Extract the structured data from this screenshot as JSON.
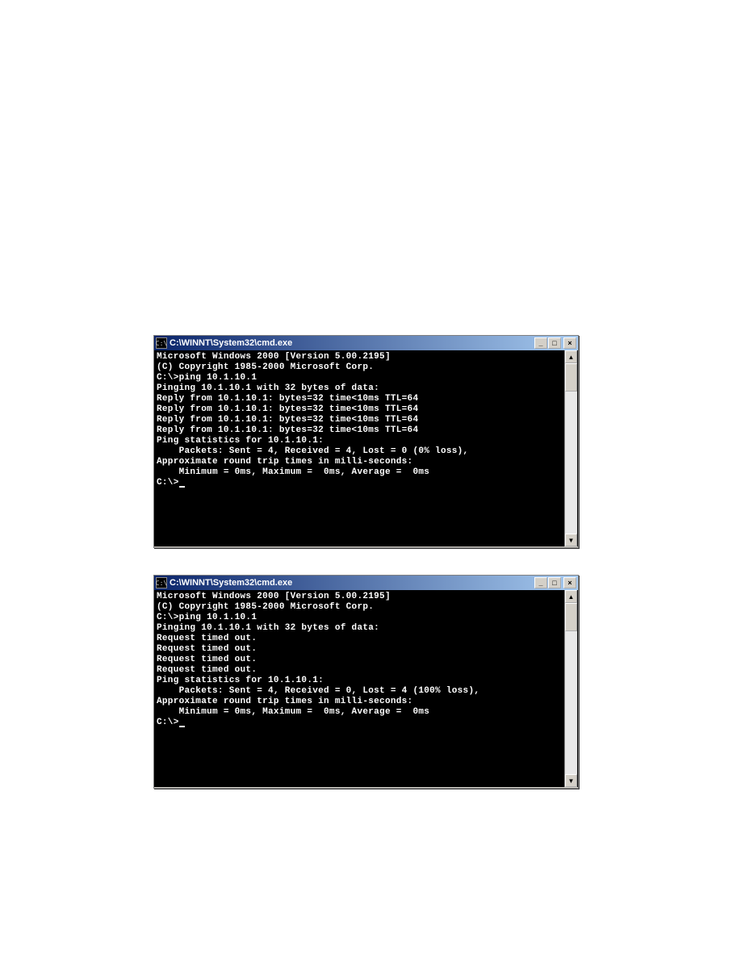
{
  "window1": {
    "icon_label": "C:\\",
    "title": "C:\\WINNT\\System32\\cmd.exe",
    "buttons": {
      "min": "_",
      "max": "□",
      "close": "×"
    },
    "scroll": {
      "up": "▲",
      "down": "▼"
    },
    "lines": [
      "Microsoft Windows 2000 [Version 5.00.2195]",
      "(C) Copyright 1985-2000 Microsoft Corp.",
      "",
      "C:\\>ping 10.1.10.1",
      "",
      "Pinging 10.1.10.1 with 32 bytes of data:",
      "",
      "Reply from 10.1.10.1: bytes=32 time<10ms TTL=64",
      "Reply from 10.1.10.1: bytes=32 time<10ms TTL=64",
      "Reply from 10.1.10.1: bytes=32 time<10ms TTL=64",
      "Reply from 10.1.10.1: bytes=32 time<10ms TTL=64",
      "",
      "Ping statistics for 10.1.10.1:",
      "    Packets: Sent = 4, Received = 4, Lost = 0 (0% loss),",
      "Approximate round trip times in milli-seconds:",
      "    Minimum = 0ms, Maximum =  0ms, Average =  0ms",
      "",
      "C:\\>"
    ]
  },
  "window2": {
    "icon_label": "C:\\",
    "title": "C:\\WINNT\\System32\\cmd.exe",
    "buttons": {
      "min": "_",
      "max": "□",
      "close": "×"
    },
    "scroll": {
      "up": "▲",
      "down": "▼"
    },
    "lines": [
      "Microsoft Windows 2000 [Version 5.00.2195]",
      "(C) Copyright 1985-2000 Microsoft Corp.",
      "",
      "C:\\>ping 10.1.10.1",
      "",
      "Pinging 10.1.10.1 with 32 bytes of data:",
      "",
      "Request timed out.",
      "Request timed out.",
      "Request timed out.",
      "Request timed out.",
      "",
      "Ping statistics for 10.1.10.1:",
      "    Packets: Sent = 4, Received = 0, Lost = 4 (100% loss),",
      "Approximate round trip times in milli-seconds:",
      "    Minimum = 0ms, Maximum =  0ms, Average =  0ms",
      "",
      "C:\\>"
    ]
  }
}
